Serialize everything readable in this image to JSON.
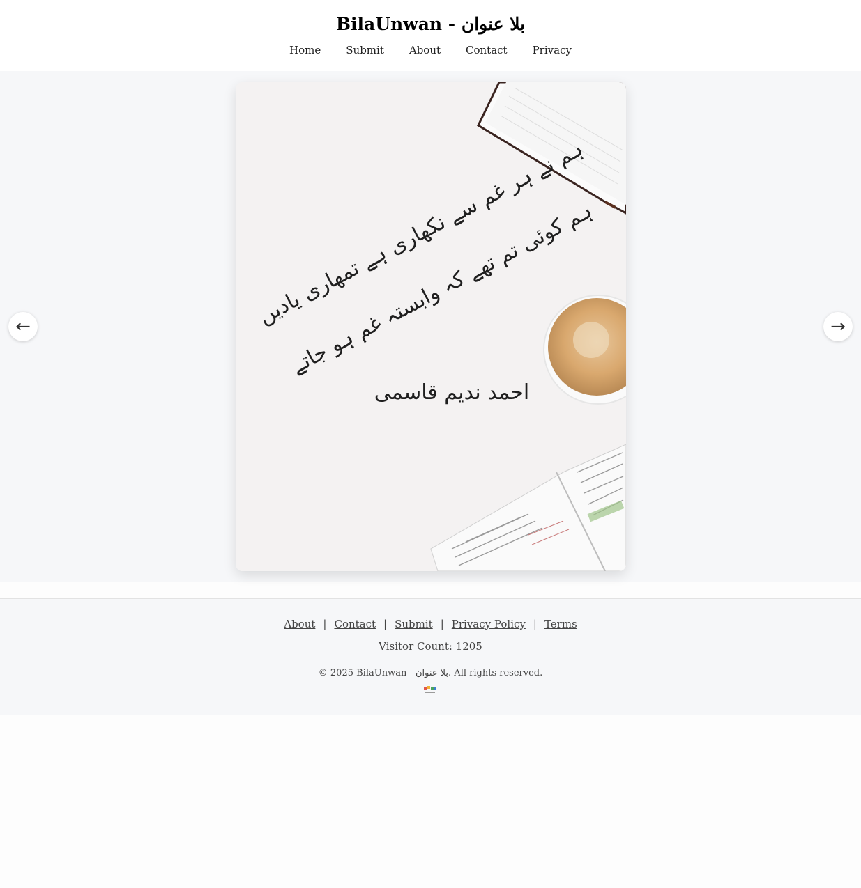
{
  "header": {
    "title": "BilaUnwan - بلا عنوان",
    "nav": [
      {
        "label": "Home"
      },
      {
        "label": "Submit"
      },
      {
        "label": "About"
      },
      {
        "label": "Contact"
      },
      {
        "label": "Privacy"
      }
    ]
  },
  "carousel": {
    "prev_icon": "←",
    "next_icon": "→",
    "slide": {
      "poem_line_1": "ہم نے ہر غم سے نکھاری ہے تمھاری یادیں",
      "poem_line_2": "ہم کوئی تم تھے کہ وابستہ غم ہو جاتے",
      "poet": "احمد ندیم قاسمی"
    }
  },
  "footer": {
    "links": [
      {
        "label": "About"
      },
      {
        "label": "Contact"
      },
      {
        "label": "Submit"
      },
      {
        "label": "Privacy Policy"
      },
      {
        "label": "Terms"
      }
    ],
    "separator": "|",
    "visitor_count": "Visitor Count: 1205",
    "copyright": "© 2025 BilaUnwan - بلا عنوان. All rights reserved."
  },
  "colors": {
    "page_bg": "#fdfdfd",
    "panel_bg": "#f6f7f9",
    "text": "#222222"
  }
}
